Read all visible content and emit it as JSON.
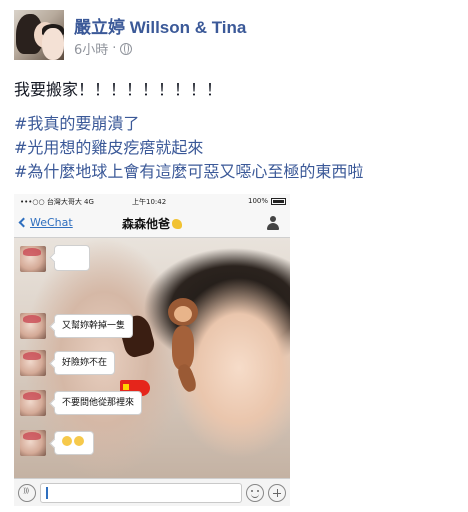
{
  "post": {
    "author": "嚴立婷 Willson & Tina",
    "time": "6小時",
    "separator": "·",
    "privacy_icon": "globe-icon",
    "text_line1": "我要搬家！！！！！！！！！",
    "hashtags": [
      "#我真的要崩潰了",
      "#光用想的雞皮疙瘩就起來",
      "#為什麼地球上會有這麼可惡又噁心至極的東西啦"
    ]
  },
  "photo": {
    "status_bar": {
      "left": "•••○○ 台灣大哥大 4G",
      "time": "上午10:42",
      "battery": "100%"
    },
    "nav": {
      "back_label": "WeChat",
      "title": "森森他爸"
    },
    "messages": [
      {
        "text": ""
      },
      {
        "text": "又幫妳幹掉一隻"
      },
      {
        "text": "好險妳不在"
      },
      {
        "text": "不要問他從那裡來"
      },
      {
        "text": ""
      }
    ]
  }
}
